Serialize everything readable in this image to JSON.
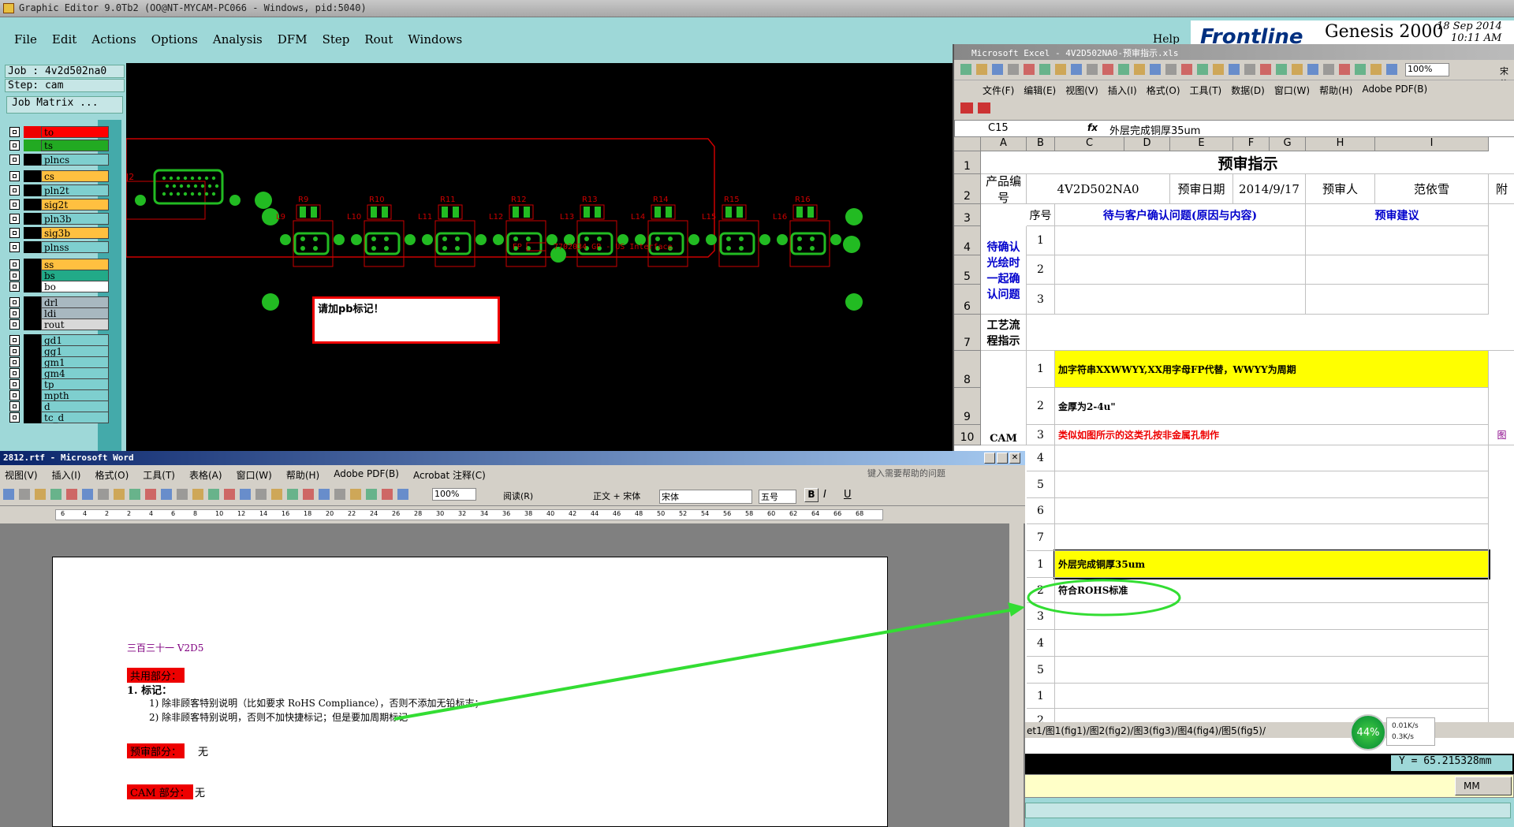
{
  "genesis": {
    "title": "Graphic Editor 9.0Tb2 (OO@NT-MYCAM-PC066 - Windows, pid:5040)",
    "menu": [
      "File",
      "Edit",
      "Actions",
      "Options",
      "Analysis",
      "DFM",
      "Step",
      "Rout",
      "Windows"
    ],
    "help": "Help",
    "logo": "Frontline",
    "product": "Genesis 2000",
    "date": "18 Sep 2014",
    "time": "10:11 AM",
    "job": "Job : 4v2d502na0",
    "step": "Step: cam",
    "job_matrix": "Job Matrix ...",
    "layers": [
      {
        "name": "to",
        "color": "#ff0000",
        "active": false
      },
      {
        "name": "ts",
        "color": "#22aa22",
        "active": true
      },
      {
        "name": "plncs",
        "color": "#7ecfcf",
        "active": false
      },
      {
        "name": "cs",
        "color": "#ffc040",
        "active": false
      },
      {
        "name": "pln2t",
        "color": "#7ecfcf",
        "active": false
      },
      {
        "name": "sig2t",
        "color": "#ffc040",
        "active": false
      },
      {
        "name": "pln3b",
        "color": "#7ecfcf",
        "active": false
      },
      {
        "name": "sig3b",
        "color": "#ffc040",
        "active": false
      },
      {
        "name": "plnss",
        "color": "#7ecfcf",
        "active": false
      },
      {
        "name": "ss",
        "color": "#ffc040",
        "active": false
      },
      {
        "name": "bs",
        "color": "#22aa88",
        "active": false
      },
      {
        "name": "bo",
        "color": "#ffffff",
        "active": false
      },
      {
        "name": "drl",
        "color": "#a8b8c0",
        "active": false
      },
      {
        "name": "ldi",
        "color": "#a8b8c0",
        "active": false
      },
      {
        "name": "rout",
        "color": "#d8d8d8",
        "active": false
      },
      {
        "name": "gd1",
        "color": "#7ecfcf",
        "active": false
      },
      {
        "name": "gg1",
        "color": "#7ecfcf",
        "active": false
      },
      {
        "name": "gm1",
        "color": "#7ecfcf",
        "active": false
      },
      {
        "name": "gm4",
        "color": "#7ecfcf",
        "active": false
      },
      {
        "name": "tp",
        "color": "#7ecfcf",
        "active": false
      },
      {
        "name": "mpth",
        "color": "#7ecfcf",
        "active": false
      },
      {
        "name": "d",
        "color": "#7ecfcf",
        "active": false
      },
      {
        "name": "tc_d",
        "color": "#7ecfcf",
        "active": false
      }
    ],
    "pcb_labels": [
      "J2",
      "R9",
      "R10",
      "R11",
      "R12",
      "R13",
      "R14",
      "R15",
      "R16",
      "L9",
      "L10",
      "L11",
      "L12",
      "L13",
      "L14",
      "L15",
      "L16"
    ],
    "pcb_text": "7702034 GP - US Interface",
    "pcb_fp": "FP",
    "note": "请加pb标记！",
    "coord_y": "Y = 65.215328mm",
    "unit": "MM"
  },
  "word": {
    "title": "2812.rtf - Microsoft Word",
    "menu": [
      "视图(V)",
      "插入(I)",
      "格式(O)",
      "工具(T)",
      "表格(A)",
      "窗口(W)",
      "帮助(H)",
      "Adobe PDF(B)",
      "Acrobat 注释(C)"
    ],
    "help_placeholder": "键入需要帮助的问题",
    "zoom": "100%",
    "read": "阅读(R)",
    "style": "正文 + 宋体",
    "font": "宋体",
    "size": "五号",
    "ruler": [
      "6",
      "4",
      "2",
      "2",
      "4",
      "6",
      "8",
      "10",
      "12",
      "14",
      "16",
      "18",
      "20",
      "22",
      "24",
      "26",
      "28",
      "30",
      "32",
      "34",
      "36",
      "38",
      "40",
      "42",
      "44",
      "46",
      "48",
      "50",
      "52",
      "54",
      "56",
      "58",
      "60",
      "62",
      "64",
      "66",
      "68"
    ],
    "lines": {
      "heading": "三百三十一 V2D5",
      "shared": "共用部分：",
      "item1": "1.   标记：",
      "sub1": "1)  除非顾客特别说明（比如要求 RoHS Compliance），否则不添加无铅标志；",
      "sub2": "2)  除非顾客特别说明，否则不加快捷标记；但是要加周期标记",
      "pre": "预审部分：",
      "pre_val": "无",
      "cam": "CAM 部分：",
      "cam_val": "无"
    }
  },
  "excel": {
    "title": "Microsoft Excel - 4V2D502NA0-预审指示.xls",
    "menu": [
      "文件(F)",
      "编辑(E)",
      "视图(V)",
      "插入(I)",
      "格式(O)",
      "工具(T)",
      "数据(D)",
      "窗口(W)",
      "帮助(H)",
      "Adobe PDF(B)"
    ],
    "font": "宋体",
    "zoom": "100%",
    "namebox": "C15",
    "formula": "外层完成铜厚35um",
    "columns": [
      "A",
      "B",
      "C",
      "D",
      "E",
      "F",
      "G",
      "H",
      "I"
    ],
    "sheet_title": "预审指示",
    "product_label": "产品编号",
    "product_val": "4V2D502NA0",
    "date_label": "预审日期",
    "date_val": "2014/9/17",
    "reviewer_label": "预审人",
    "reviewer_val": "范依雪",
    "attach": "附",
    "seq": "序号",
    "question_hdr": "待与客户确认问题(原因与内容)",
    "suggest_hdr": "预审建议",
    "pending": "待确认光绘时一起确认问题",
    "process": "工艺流程指示",
    "cam": "CAM",
    "r8": "加字符串XXWWYY,XX用字母FP代替，WWYY为周期",
    "r9": "金厚为2-4u\"",
    "r10": "类似如图所示的这类孔按非金属孔制作",
    "r10b": "图",
    "r15": "外层完成铜厚35um",
    "r16": "符合ROHS标准",
    "tabs": "et1/图1(fig1)/图2(fig2)/图3(fig3)/图4(fig4)/图5(fig5)/",
    "net_pct": "44%",
    "net_up": "0.01K/s",
    "net_down": "0.3K/s"
  }
}
